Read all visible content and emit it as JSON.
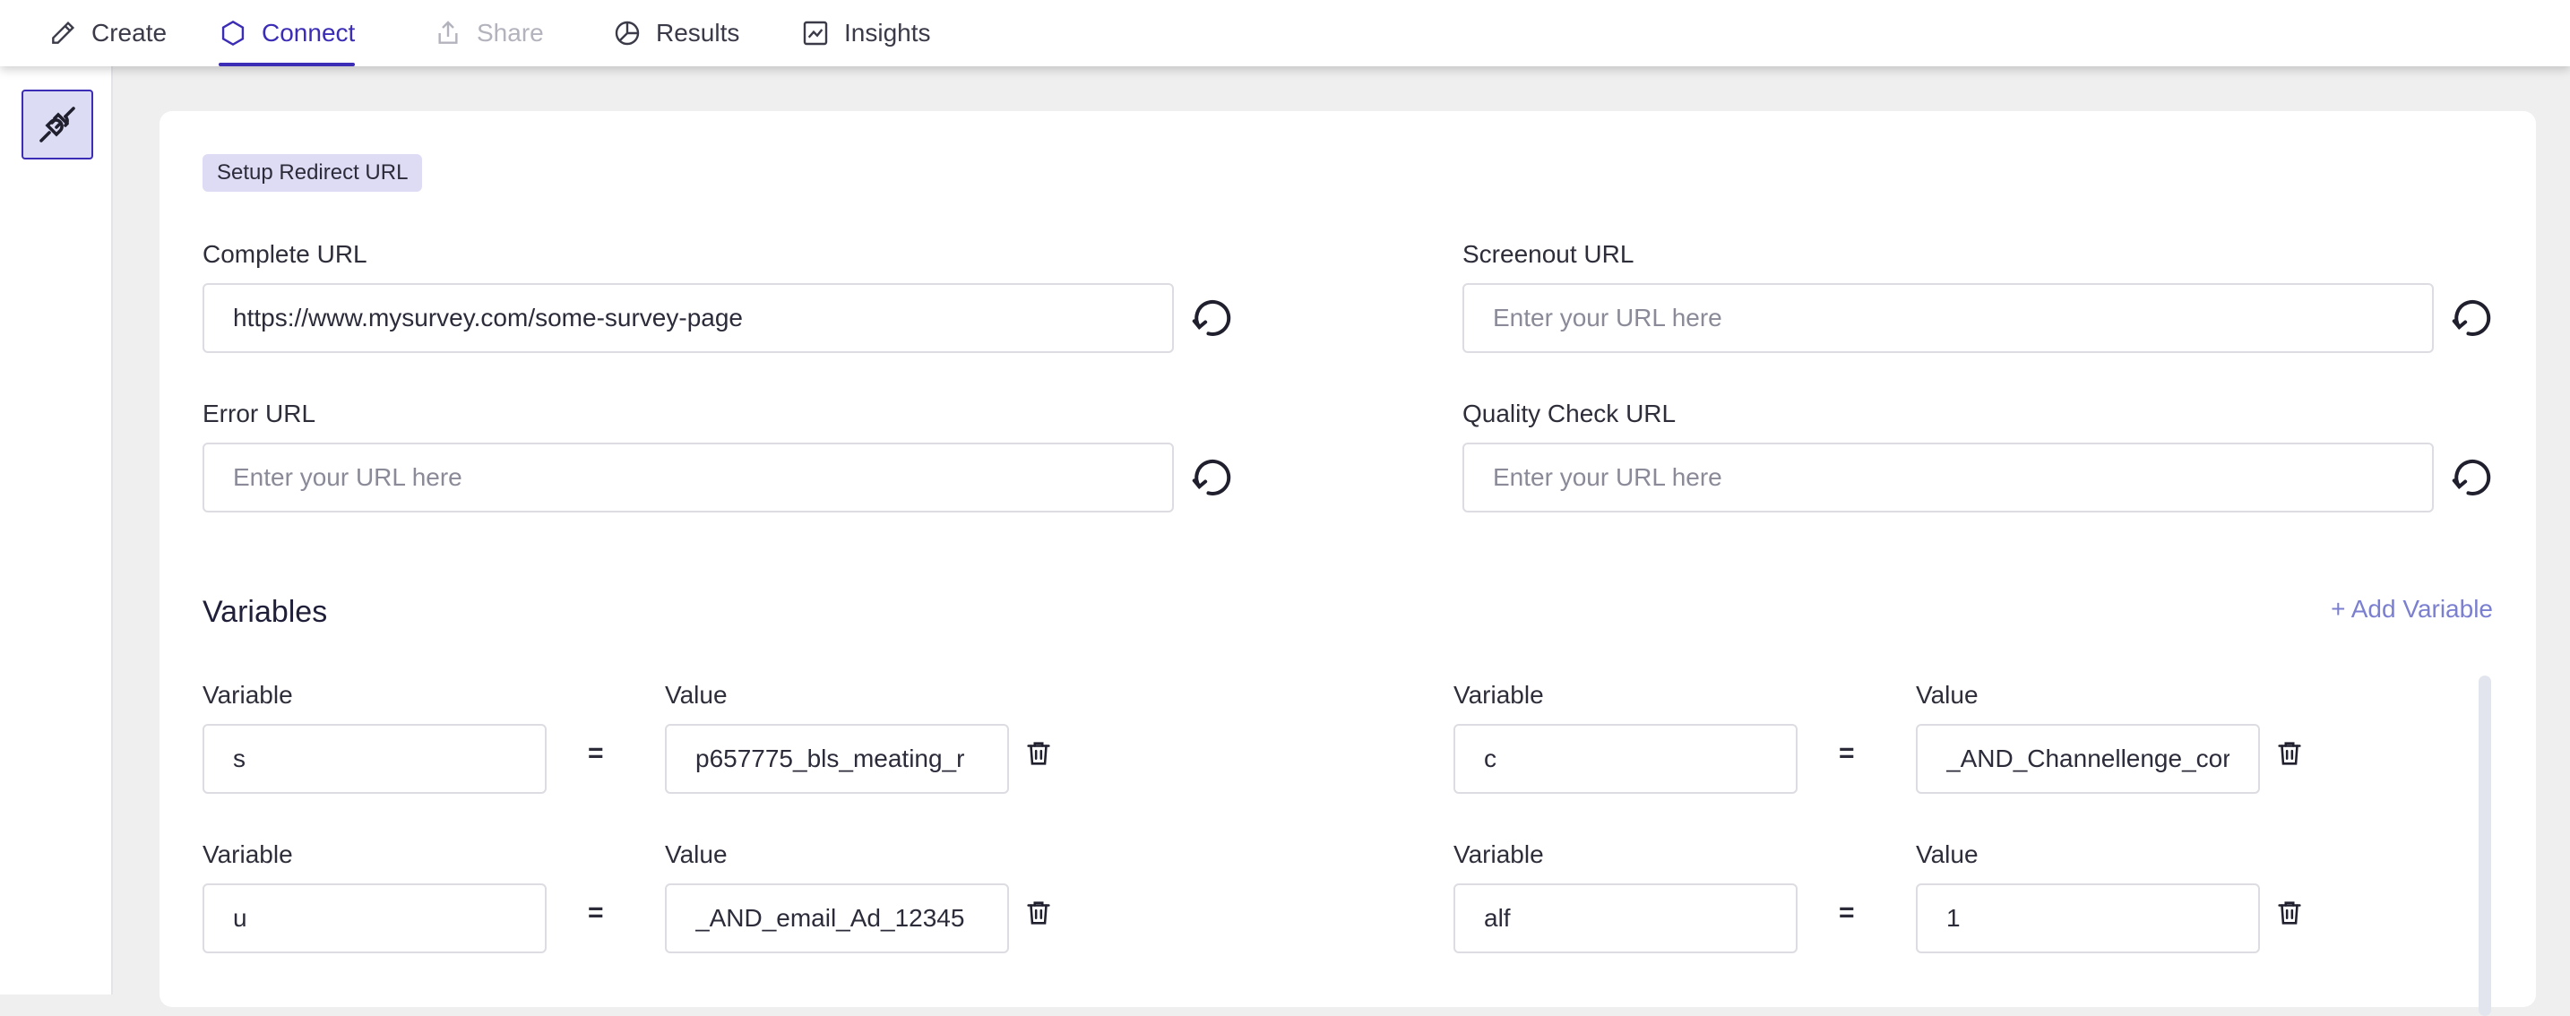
{
  "nav": {
    "tabs": [
      {
        "label": "Create",
        "icon": "pencil-icon",
        "state": "normal"
      },
      {
        "label": "Connect",
        "icon": "hexagon-icon",
        "state": "active"
      },
      {
        "label": "Share",
        "icon": "share-icon",
        "state": "disabled"
      },
      {
        "label": "Results",
        "icon": "pie-chart-icon",
        "state": "normal"
      },
      {
        "label": "Insights",
        "icon": "line-chart-icon",
        "state": "normal"
      }
    ]
  },
  "rail": {
    "icon": "plug-icon"
  },
  "redirect": {
    "chip": "Setup Redirect URL",
    "complete": {
      "label": "Complete URL",
      "value": "https://www.mysurvey.com/some-survey-page",
      "placeholder": "Enter your URL here"
    },
    "screenout": {
      "label": "Screenout URL",
      "value": "",
      "placeholder": "Enter your URL here"
    },
    "error": {
      "label": "Error URL",
      "value": "",
      "placeholder": "Enter your URL here"
    },
    "quality": {
      "label": "Quality Check URL",
      "value": "",
      "placeholder": "Enter your URL here"
    }
  },
  "variables": {
    "title": "Variables",
    "add_label": "+ Add Variable",
    "variable_label": "Variable",
    "value_label": "Value",
    "equals": "=",
    "rows": [
      {
        "variable": "s",
        "value": "p657775_bls_meating_r"
      },
      {
        "variable": "c",
        "value": "_AND_Channellenge_cor"
      },
      {
        "variable": "u",
        "value": "_AND_email_Ad_12345"
      },
      {
        "variable": "alf",
        "value": "1"
      }
    ]
  },
  "colors": {
    "accent": "#3b2db5",
    "chip_bg": "#dedcf4",
    "link": "#7b7fd0"
  }
}
